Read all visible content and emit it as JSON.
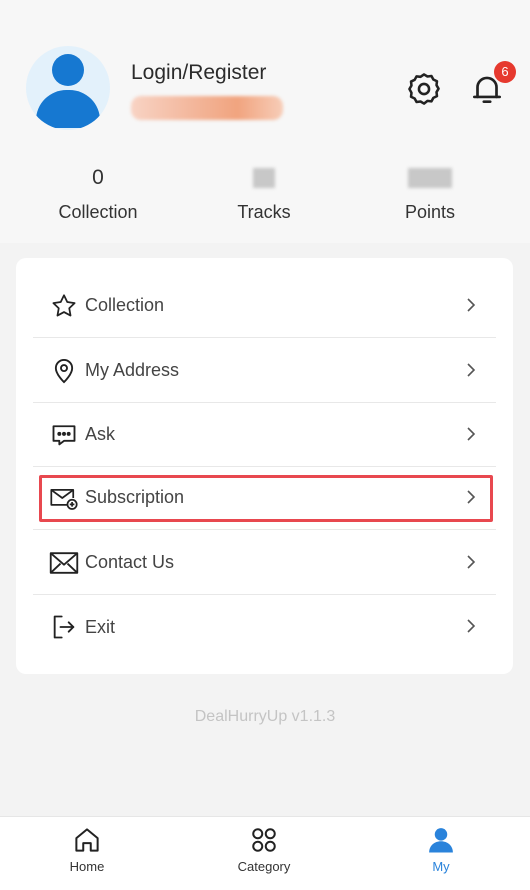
{
  "profile": {
    "login_label": "Login/Register",
    "notification_count": "6"
  },
  "stats": [
    {
      "value": "0",
      "label": "Collection"
    },
    {
      "value": "",
      "label": "Tracks"
    },
    {
      "value": "",
      "label": "Points"
    }
  ],
  "menu": [
    {
      "label": "Collection",
      "icon": "star-icon"
    },
    {
      "label": "My Address",
      "icon": "location-pin-icon"
    },
    {
      "label": "Ask",
      "icon": "chat-bubble-icon"
    },
    {
      "label": "Subscription",
      "icon": "mail-plus-icon"
    },
    {
      "label": "Contact Us",
      "icon": "envelope-icon"
    },
    {
      "label": "Exit",
      "icon": "logout-icon"
    }
  ],
  "version": "DealHurryUp v1.1.3",
  "tabs": [
    {
      "label": "Home",
      "icon": "home-icon",
      "active": false
    },
    {
      "label": "Category",
      "icon": "grid-icon",
      "active": false
    },
    {
      "label": "My",
      "icon": "user-icon",
      "active": true
    }
  ],
  "colors": {
    "accent": "#2a83db",
    "avatar": "#1678d1",
    "badge": "#e6392e",
    "highlight": "#e8484f"
  }
}
